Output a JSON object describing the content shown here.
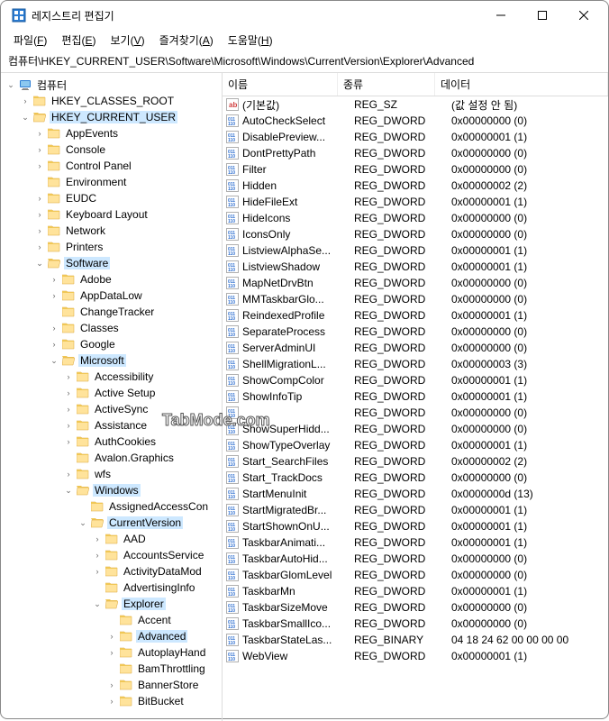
{
  "title": "레지스트리 편집기",
  "menu": [
    {
      "label": "파일",
      "key": "F"
    },
    {
      "label": "편집",
      "key": "E"
    },
    {
      "label": "보기",
      "key": "V"
    },
    {
      "label": "즐겨찾기",
      "key": "A"
    },
    {
      "label": "도움말",
      "key": "H"
    }
  ],
  "address": "컴퓨터\\HKEY_CURRENT_USER\\Software\\Microsoft\\Windows\\CurrentVersion\\Explorer\\Advanced",
  "columns": {
    "name": "이름",
    "type": "종류",
    "data": "데이터"
  },
  "rootLabel": "컴퓨터",
  "tree": [
    {
      "label": "HKEY_CLASSES_ROOT",
      "depth": 0,
      "exp": ">",
      "closed": true
    },
    {
      "label": "HKEY_CURRENT_USER",
      "depth": 0,
      "exp": "v",
      "sel": true
    },
    {
      "label": "AppEvents",
      "depth": 1,
      "exp": ">",
      "closed": true
    },
    {
      "label": "Console",
      "depth": 1,
      "exp": ">",
      "closed": true
    },
    {
      "label": "Control Panel",
      "depth": 1,
      "exp": ">",
      "closed": true
    },
    {
      "label": "Environment",
      "depth": 1,
      "exp": "",
      "closed": true
    },
    {
      "label": "EUDC",
      "depth": 1,
      "exp": ">",
      "closed": true
    },
    {
      "label": "Keyboard Layout",
      "depth": 1,
      "exp": ">",
      "closed": true
    },
    {
      "label": "Network",
      "depth": 1,
      "exp": ">",
      "closed": true
    },
    {
      "label": "Printers",
      "depth": 1,
      "exp": ">",
      "closed": true
    },
    {
      "label": "Software",
      "depth": 1,
      "exp": "v",
      "sel": true
    },
    {
      "label": "Adobe",
      "depth": 2,
      "exp": ">",
      "closed": true
    },
    {
      "label": "AppDataLow",
      "depth": 2,
      "exp": ">",
      "closed": true
    },
    {
      "label": "ChangeTracker",
      "depth": 2,
      "exp": "",
      "closed": true
    },
    {
      "label": "Classes",
      "depth": 2,
      "exp": ">",
      "closed": true
    },
    {
      "label": "Google",
      "depth": 2,
      "exp": ">",
      "closed": true
    },
    {
      "label": "Microsoft",
      "depth": 2,
      "exp": "v",
      "sel": true
    },
    {
      "label": "Accessibility",
      "depth": 3,
      "exp": ">",
      "closed": true
    },
    {
      "label": "Active Setup",
      "depth": 3,
      "exp": ">",
      "closed": true
    },
    {
      "label": "ActiveSync",
      "depth": 3,
      "exp": ">",
      "closed": true
    },
    {
      "label": "Assistance",
      "depth": 3,
      "exp": ">",
      "closed": true
    },
    {
      "label": "AuthCookies",
      "depth": 3,
      "exp": ">",
      "closed": true
    },
    {
      "label": "Avalon.Graphics",
      "depth": 3,
      "exp": "",
      "closed": true
    },
    {
      "label": "wfs",
      "depth": 3,
      "exp": ">",
      "closed": true
    },
    {
      "label": "Windows",
      "depth": 3,
      "exp": "v",
      "sel": true
    },
    {
      "label": "AssignedAccessCon",
      "depth": 4,
      "exp": "",
      "closed": true
    },
    {
      "label": "CurrentVersion",
      "depth": 4,
      "exp": "v",
      "sel": true
    },
    {
      "label": "AAD",
      "depth": 5,
      "exp": ">",
      "closed": true
    },
    {
      "label": "AccountsService",
      "depth": 5,
      "exp": ">",
      "closed": true
    },
    {
      "label": "ActivityDataMod",
      "depth": 5,
      "exp": ">",
      "closed": true
    },
    {
      "label": "AdvertisingInfo",
      "depth": 5,
      "exp": "",
      "closed": true
    },
    {
      "label": "Explorer",
      "depth": 5,
      "exp": "v",
      "sel": true
    },
    {
      "label": "Accent",
      "depth": 6,
      "exp": "",
      "closed": true
    },
    {
      "label": "Advanced",
      "depth": 6,
      "exp": ">",
      "closed": true,
      "sel": true
    },
    {
      "label": "AutoplayHand",
      "depth": 6,
      "exp": ">",
      "closed": true
    },
    {
      "label": "BamThrottling",
      "depth": 6,
      "exp": "",
      "closed": true
    },
    {
      "label": "BannerStore",
      "depth": 6,
      "exp": ">",
      "closed": true
    },
    {
      "label": "BitBucket",
      "depth": 6,
      "exp": ">",
      "closed": true
    }
  ],
  "values": [
    {
      "name": "(기본값)",
      "type": "REG_SZ",
      "data": "(값 설정 안 됨)",
      "kind": "sz"
    },
    {
      "name": "AutoCheckSelect",
      "type": "REG_DWORD",
      "data": "0x00000000 (0)",
      "kind": "bin"
    },
    {
      "name": "DisablePreview...",
      "type": "REG_DWORD",
      "data": "0x00000001 (1)",
      "kind": "bin"
    },
    {
      "name": "DontPrettyPath",
      "type": "REG_DWORD",
      "data": "0x00000000 (0)",
      "kind": "bin"
    },
    {
      "name": "Filter",
      "type": "REG_DWORD",
      "data": "0x00000000 (0)",
      "kind": "bin"
    },
    {
      "name": "Hidden",
      "type": "REG_DWORD",
      "data": "0x00000002 (2)",
      "kind": "bin"
    },
    {
      "name": "HideFileExt",
      "type": "REG_DWORD",
      "data": "0x00000001 (1)",
      "kind": "bin"
    },
    {
      "name": "HideIcons",
      "type": "REG_DWORD",
      "data": "0x00000000 (0)",
      "kind": "bin"
    },
    {
      "name": "IconsOnly",
      "type": "REG_DWORD",
      "data": "0x00000000 (0)",
      "kind": "bin"
    },
    {
      "name": "ListviewAlphaSe...",
      "type": "REG_DWORD",
      "data": "0x00000001 (1)",
      "kind": "bin"
    },
    {
      "name": "ListviewShadow",
      "type": "REG_DWORD",
      "data": "0x00000001 (1)",
      "kind": "bin"
    },
    {
      "name": "MapNetDrvBtn",
      "type": "REG_DWORD",
      "data": "0x00000000 (0)",
      "kind": "bin"
    },
    {
      "name": "MMTaskbarGlo...",
      "type": "REG_DWORD",
      "data": "0x00000000 (0)",
      "kind": "bin"
    },
    {
      "name": "ReindexedProfile",
      "type": "REG_DWORD",
      "data": "0x00000001 (1)",
      "kind": "bin"
    },
    {
      "name": "SeparateProcess",
      "type": "REG_DWORD",
      "data": "0x00000000 (0)",
      "kind": "bin"
    },
    {
      "name": "ServerAdminUI",
      "type": "REG_DWORD",
      "data": "0x00000000 (0)",
      "kind": "bin"
    },
    {
      "name": "ShellMigrationL...",
      "type": "REG_DWORD",
      "data": "0x00000003 (3)",
      "kind": "bin"
    },
    {
      "name": "ShowCompColor",
      "type": "REG_DWORD",
      "data": "0x00000001 (1)",
      "kind": "bin"
    },
    {
      "name": "ShowInfoTip",
      "type": "REG_DWORD",
      "data": "0x00000001 (1)",
      "kind": "bin"
    },
    {
      "name": "",
      "type": "REG_DWORD",
      "data": "0x00000000 (0)",
      "kind": "bin"
    },
    {
      "name": "ShowSuperHidd...",
      "type": "REG_DWORD",
      "data": "0x00000000 (0)",
      "kind": "bin"
    },
    {
      "name": "ShowTypeOverlay",
      "type": "REG_DWORD",
      "data": "0x00000001 (1)",
      "kind": "bin"
    },
    {
      "name": "Start_SearchFiles",
      "type": "REG_DWORD",
      "data": "0x00000002 (2)",
      "kind": "bin"
    },
    {
      "name": "Start_TrackDocs",
      "type": "REG_DWORD",
      "data": "0x00000000 (0)",
      "kind": "bin"
    },
    {
      "name": "StartMenuInit",
      "type": "REG_DWORD",
      "data": "0x0000000d (13)",
      "kind": "bin"
    },
    {
      "name": "StartMigratedBr...",
      "type": "REG_DWORD",
      "data": "0x00000001 (1)",
      "kind": "bin"
    },
    {
      "name": "StartShownOnU...",
      "type": "REG_DWORD",
      "data": "0x00000001 (1)",
      "kind": "bin"
    },
    {
      "name": "TaskbarAnimati...",
      "type": "REG_DWORD",
      "data": "0x00000001 (1)",
      "kind": "bin"
    },
    {
      "name": "TaskbarAutoHid...",
      "type": "REG_DWORD",
      "data": "0x00000000 (0)",
      "kind": "bin"
    },
    {
      "name": "TaskbarGlomLevel",
      "type": "REG_DWORD",
      "data": "0x00000000 (0)",
      "kind": "bin"
    },
    {
      "name": "TaskbarMn",
      "type": "REG_DWORD",
      "data": "0x00000001 (1)",
      "kind": "bin"
    },
    {
      "name": "TaskbarSizeMove",
      "type": "REG_DWORD",
      "data": "0x00000000 (0)",
      "kind": "bin"
    },
    {
      "name": "TaskbarSmallIco...",
      "type": "REG_DWORD",
      "data": "0x00000000 (0)",
      "kind": "bin"
    },
    {
      "name": "TaskbarStateLas...",
      "type": "REG_BINARY",
      "data": "04 18 24 62 00 00 00 00",
      "kind": "bin"
    },
    {
      "name": "WebView",
      "type": "REG_DWORD",
      "data": "0x00000001 (1)",
      "kind": "bin"
    }
  ],
  "watermark": "TabMode.com"
}
